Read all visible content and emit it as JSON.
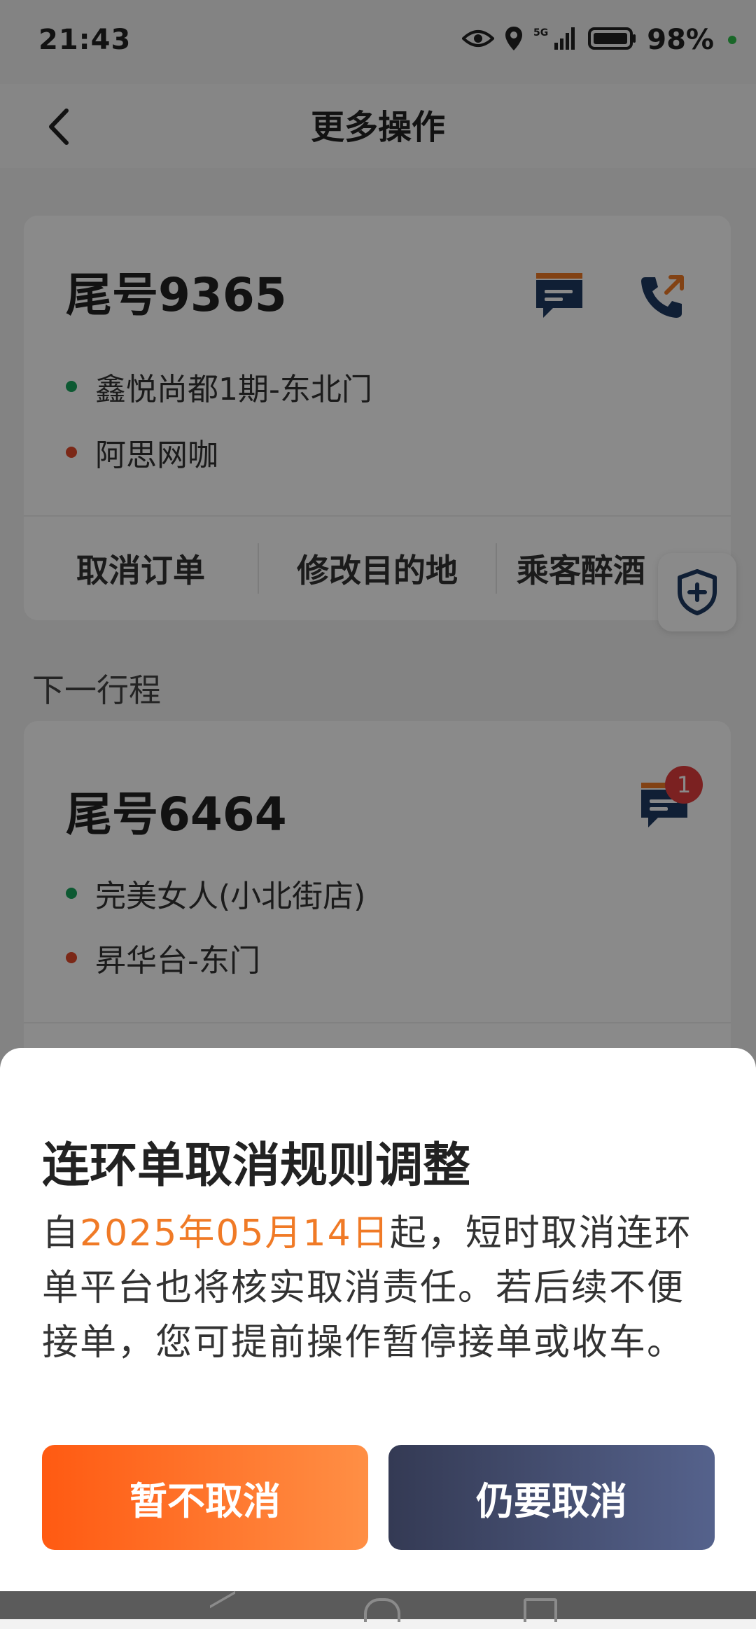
{
  "status_bar": {
    "time": "21:43",
    "battery_pct": "98%",
    "network": "5G"
  },
  "header": {
    "title": "更多操作"
  },
  "current_trip": {
    "tail": "尾号9365",
    "pickup": "鑫悦尚都1期-东北门",
    "destination": "阿思网咖",
    "actions": [
      "取消订单",
      "修改目的地",
      "乘客醉酒"
    ]
  },
  "next_section_title": "下一行程",
  "next_trip": {
    "tail": "尾号6464",
    "pickup": "完美女人(小北街店)",
    "destination": "昇华台-东门",
    "unread_badge": "1"
  },
  "dialog": {
    "title": "连环单取消规则调整",
    "body_prefix": "自",
    "body_date": "2025年05月14日",
    "body_suffix": "起，短时取消连环单平台也将核实取消责任。若后续不便接单，您可提前操作暂停接单或收车。",
    "keep_button": "暂不取消",
    "cancel_button": "仍要取消"
  },
  "colors": {
    "accent_orange": "#f07a26",
    "icon_navy": "#1f3a63",
    "dark_button": "#3b4260"
  }
}
